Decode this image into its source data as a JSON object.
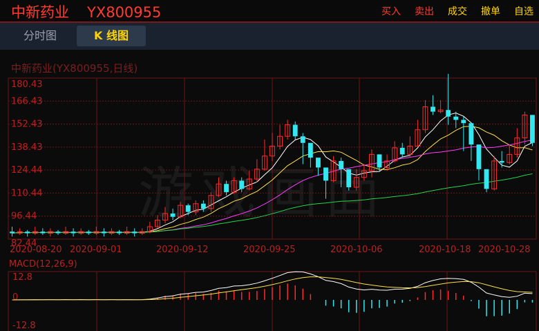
{
  "header": {
    "stock_name": "中新药业",
    "stock_code": "YX800955",
    "actions": [
      {
        "label": "买入",
        "color": "#ff3b30"
      },
      {
        "label": "卖出",
        "color": "#ff3b30"
      },
      {
        "label": "成交",
        "color": "#ffd400"
      },
      {
        "label": "撤单",
        "color": "#ffd400"
      },
      {
        "label": "自选",
        "color": "#ffd400"
      }
    ]
  },
  "tabs": [
    {
      "label": "分时图",
      "active": false
    },
    {
      "label": "K 线图",
      "active": true
    }
  ],
  "chart_title": "中新药业(YX800955,日线)",
  "watermark": "游戏画面",
  "colors": {
    "up": "#ff2a2a",
    "down": "#33e8f0",
    "ma5": "#ffffff",
    "ma10": "#ffe24a",
    "ma20": "#ff3cff",
    "ma60": "#22d64a",
    "grid": "#6e1616"
  },
  "chart_data": {
    "type": "candlestick",
    "y_ticks": [
      "180.43",
      "166.43",
      "152.43",
      "138.43",
      "124.44",
      "110.44",
      "96.44",
      "82.44"
    ],
    "ylim": [
      82.44,
      180.43
    ],
    "x_ticks": [
      {
        "label": "2020-08-20",
        "index": 0
      },
      {
        "label": "2020-09-01",
        "index": 8
      },
      {
        "label": "2020-09-12",
        "index": 17
      },
      {
        "label": "2020-09-25",
        "index": 26
      },
      {
        "label": "2020-10-06",
        "index": 35
      },
      {
        "label": "2020-10-18",
        "index": 44
      },
      {
        "label": "2020-10-28",
        "index": 51
      }
    ],
    "candles": [
      [
        87,
        86,
        90,
        84
      ],
      [
        86,
        87,
        89,
        85
      ],
      [
        87,
        86,
        88,
        84
      ],
      [
        86,
        87,
        90,
        85
      ],
      [
        87,
        86,
        89,
        85
      ],
      [
        86,
        87,
        89,
        84
      ],
      [
        87,
        86,
        88,
        85
      ],
      [
        86,
        87,
        90,
        85
      ],
      [
        87,
        86,
        89,
        84
      ],
      [
        86,
        87,
        89,
        85
      ],
      [
        87,
        86,
        88,
        85
      ],
      [
        86,
        87,
        90,
        85
      ],
      [
        87,
        86,
        89,
        84
      ],
      [
        86,
        87,
        89,
        85
      ],
      [
        87,
        86,
        88,
        85
      ],
      [
        86,
        87,
        90,
        85
      ],
      [
        87,
        86,
        89,
        84
      ],
      [
        86,
        87,
        89,
        85
      ],
      [
        87,
        90,
        93,
        86
      ],
      [
        90,
        94,
        97,
        89
      ],
      [
        94,
        98,
        102,
        92
      ],
      [
        98,
        96,
        101,
        94
      ],
      [
        96,
        103,
        105,
        95
      ],
      [
        103,
        99,
        104,
        97
      ],
      [
        99,
        104,
        106,
        97
      ],
      [
        104,
        101,
        106,
        99
      ],
      [
        101,
        109,
        111,
        99
      ],
      [
        109,
        116,
        120,
        108
      ],
      [
        116,
        111,
        118,
        109
      ],
      [
        111,
        118,
        120,
        110
      ],
      [
        118,
        113,
        120,
        111
      ],
      [
        113,
        119,
        124,
        112
      ],
      [
        119,
        125,
        131,
        117
      ],
      [
        125,
        133,
        143,
        124
      ],
      [
        133,
        139,
        147,
        130
      ],
      [
        139,
        145,
        152,
        137
      ],
      [
        145,
        152,
        155,
        143
      ],
      [
        152,
        145,
        154,
        143
      ],
      [
        145,
        141,
        147,
        128
      ],
      [
        141,
        132,
        136,
        126
      ],
      [
        132,
        126,
        128,
        121
      ],
      [
        126,
        118,
        121,
        107
      ],
      [
        118,
        130,
        133,
        117
      ],
      [
        130,
        125,
        132,
        114
      ],
      [
        125,
        114,
        122,
        112
      ],
      [
        114,
        120,
        125,
        112
      ],
      [
        120,
        124,
        128,
        118
      ],
      [
        124,
        134,
        137,
        120
      ],
      [
        134,
        126,
        130,
        124
      ],
      [
        126,
        130,
        134,
        124
      ],
      [
        130,
        138,
        142,
        129
      ],
      [
        138,
        134,
        141,
        132
      ],
      [
        134,
        139,
        145,
        132
      ],
      [
        139,
        149,
        155,
        139
      ],
      [
        149,
        163,
        167,
        147
      ],
      [
        163,
        160,
        170,
        158
      ],
      [
        160,
        161,
        167,
        159
      ],
      [
        161,
        157,
        183,
        152
      ],
      [
        157,
        155,
        160,
        150
      ],
      [
        155,
        153,
        157,
        136
      ],
      [
        153,
        140,
        143,
        130
      ],
      [
        140,
        125,
        130,
        118
      ],
      [
        125,
        113,
        115,
        111
      ],
      [
        113,
        130,
        133,
        112
      ],
      [
        130,
        129,
        136,
        126
      ],
      [
        129,
        134,
        140,
        128
      ],
      [
        134,
        144,
        150,
        132
      ],
      [
        144,
        158,
        160,
        140
      ],
      [
        158,
        141,
        145,
        139
      ]
    ],
    "macd": {
      "ylim": [
        -12.8,
        12.8
      ],
      "y_ticks": [
        "12.8",
        "0",
        "-12.8"
      ],
      "title": "MACD(12,26,9)"
    }
  }
}
